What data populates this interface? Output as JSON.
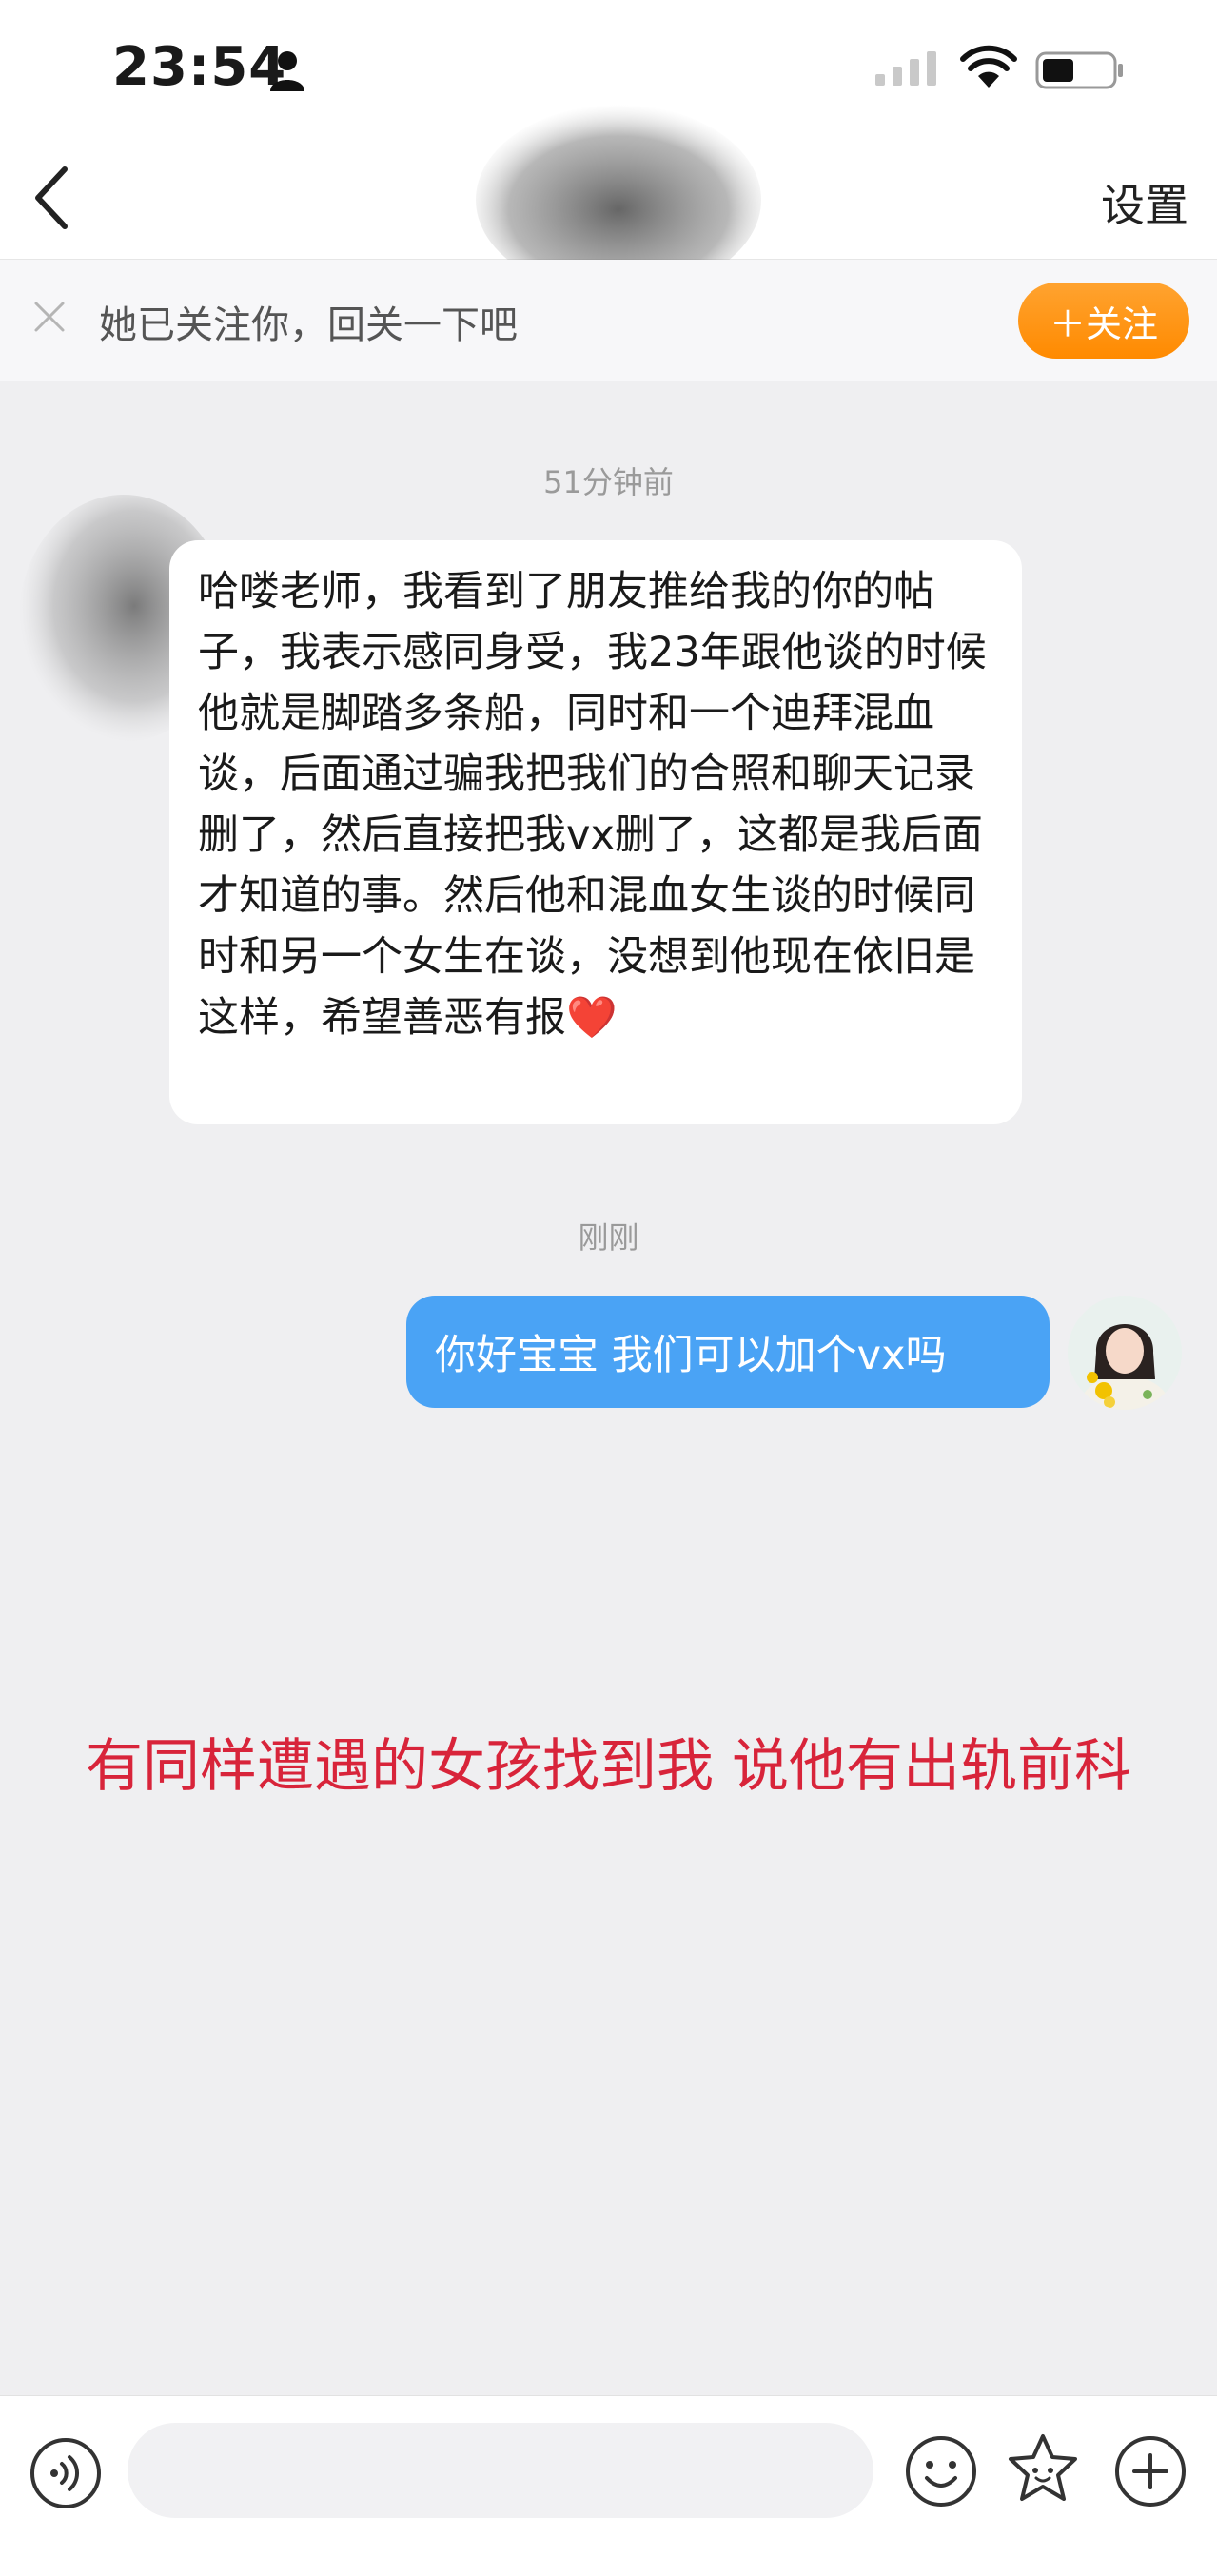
{
  "status_bar": {
    "time": "23:54",
    "icons": [
      "person-icon",
      "signal-icon",
      "wifi-icon",
      "battery-icon"
    ]
  },
  "nav": {
    "back_icon": "chevron-left-icon",
    "settings_label": "设置"
  },
  "follow_prompt": {
    "text": "她已关注你，回关一下吧",
    "button_label": "＋关注",
    "close_icon": "close-icon"
  },
  "messages": [
    {
      "time_label": "51分钟前",
      "direction": "incoming",
      "text": "哈喽老师，我看到了朋友推给我的你的帖子，我表示感同身受，我23年跟他谈的时候他就是脚踏多条船，同时和一个迪拜混血谈，后面通过骗我把我们的合照和聊天记录删了，然后直接把我vx删了，这都是我后面才知道的事。然后他和混血女生谈的时候同时和另一个女生在谈，没想到他现在依旧是这样，希望善恶有报",
      "emoji": "❤️"
    },
    {
      "time_label": "刚刚",
      "direction": "outgoing",
      "text": "你好宝宝 我们可以加个vx吗"
    }
  ],
  "annotation": "有同样遭遇的女孩找到我 说他有出轨前科",
  "input_bar": {
    "placeholder": "",
    "icons": [
      "voice-icon",
      "emoji-icon",
      "sticker-icon",
      "plus-icon"
    ]
  },
  "colors": {
    "accent_orange": "#ff8a00",
    "outgoing_bubble": "#4aa3f5",
    "annotation_red": "#d8243a",
    "chat_background": "#efeff1"
  }
}
